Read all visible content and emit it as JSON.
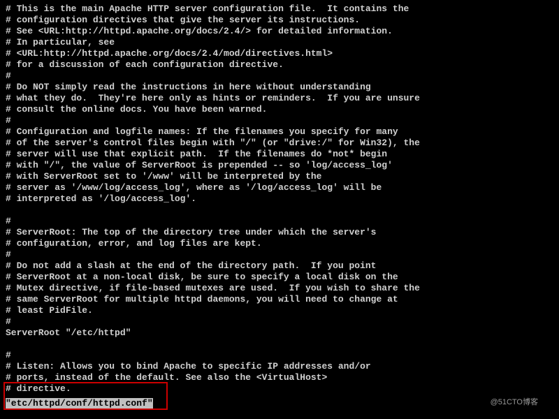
{
  "config_lines": [
    "# This is the main Apache HTTP server configuration file.  It contains the",
    "# configuration directives that give the server its instructions.",
    "# See <URL:http://httpd.apache.org/docs/2.4/> for detailed information.",
    "# In particular, see",
    "# <URL:http://httpd.apache.org/docs/2.4/mod/directives.html>",
    "# for a discussion of each configuration directive.",
    "#",
    "# Do NOT simply read the instructions in here without understanding",
    "# what they do.  They're here only as hints or reminders.  If you are unsure",
    "# consult the online docs. You have been warned.",
    "#",
    "# Configuration and logfile names: If the filenames you specify for many",
    "# of the server's control files begin with \"/\" (or \"drive:/\" for Win32), the",
    "# server will use that explicit path.  If the filenames do *not* begin",
    "# with \"/\", the value of ServerRoot is prepended -- so 'log/access_log'",
    "# with ServerRoot set to '/www' will be interpreted by the",
    "# server as '/www/log/access_log', where as '/log/access_log' will be",
    "# interpreted as '/log/access_log'.",
    "",
    "#",
    "# ServerRoot: The top of the directory tree under which the server's",
    "# configuration, error, and log files are kept.",
    "#",
    "# Do not add a slash at the end of the directory path.  If you point",
    "# ServerRoot at a non-local disk, be sure to specify a local disk on the",
    "# Mutex directive, if file-based mutexes are used.  If you wish to share the",
    "# same ServerRoot for multiple httpd daemons, you will need to change at",
    "# least PidFile.",
    "#",
    "ServerRoot \"/etc/httpd\"",
    "",
    "#",
    "# Listen: Allows you to bind Apache to specific IP addresses and/or",
    "# ports, instead of the default. See also the <VirtualHost>",
    "# directive."
  ],
  "status_path": "\"etc/httpd/conf/httpd.conf\"",
  "watermark": "@51CTO博客"
}
